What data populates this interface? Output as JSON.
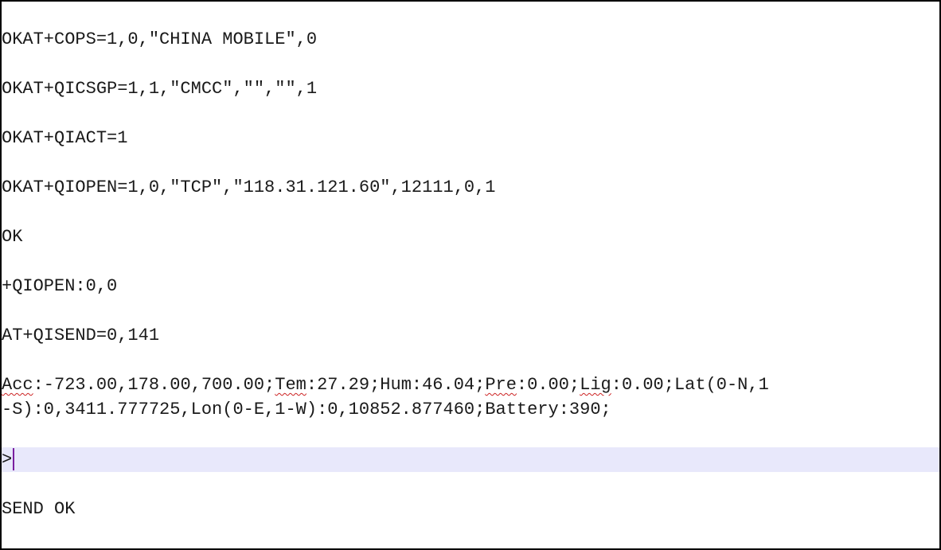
{
  "editor": {
    "lines": [
      "OKAT+COPS=1,0,\"CHINA MOBILE\",0",
      "OKAT+QICSGP=1,1,\"CMCC\",\"\",\"\",1",
      "OKAT+QIACT=1",
      "OKAT+QIOPEN=1,0,\"TCP\",\"118.31.121.60\",12111,0,1",
      "OK",
      "+QIOPEN:0,0",
      "AT+QISEND=0,141"
    ],
    "payload": {
      "acc_label": "Acc",
      "acc_rest": ":-723.00,178.00,700.00;",
      "tem_label": "Tem",
      "tem_rest": ":27.29;Hum:46.04;",
      "pre_label": "Pre",
      "pre_rest": ":0.00;",
      "lig_label": "Lig",
      "lig_rest": ":0.00;Lat(0-N,1",
      "line2": "-S):0,3411.777725,Lon(0-E,1-W):0,10852.877460;Battery:390;"
    },
    "prompt": ">",
    "final": "SEND OK"
  }
}
